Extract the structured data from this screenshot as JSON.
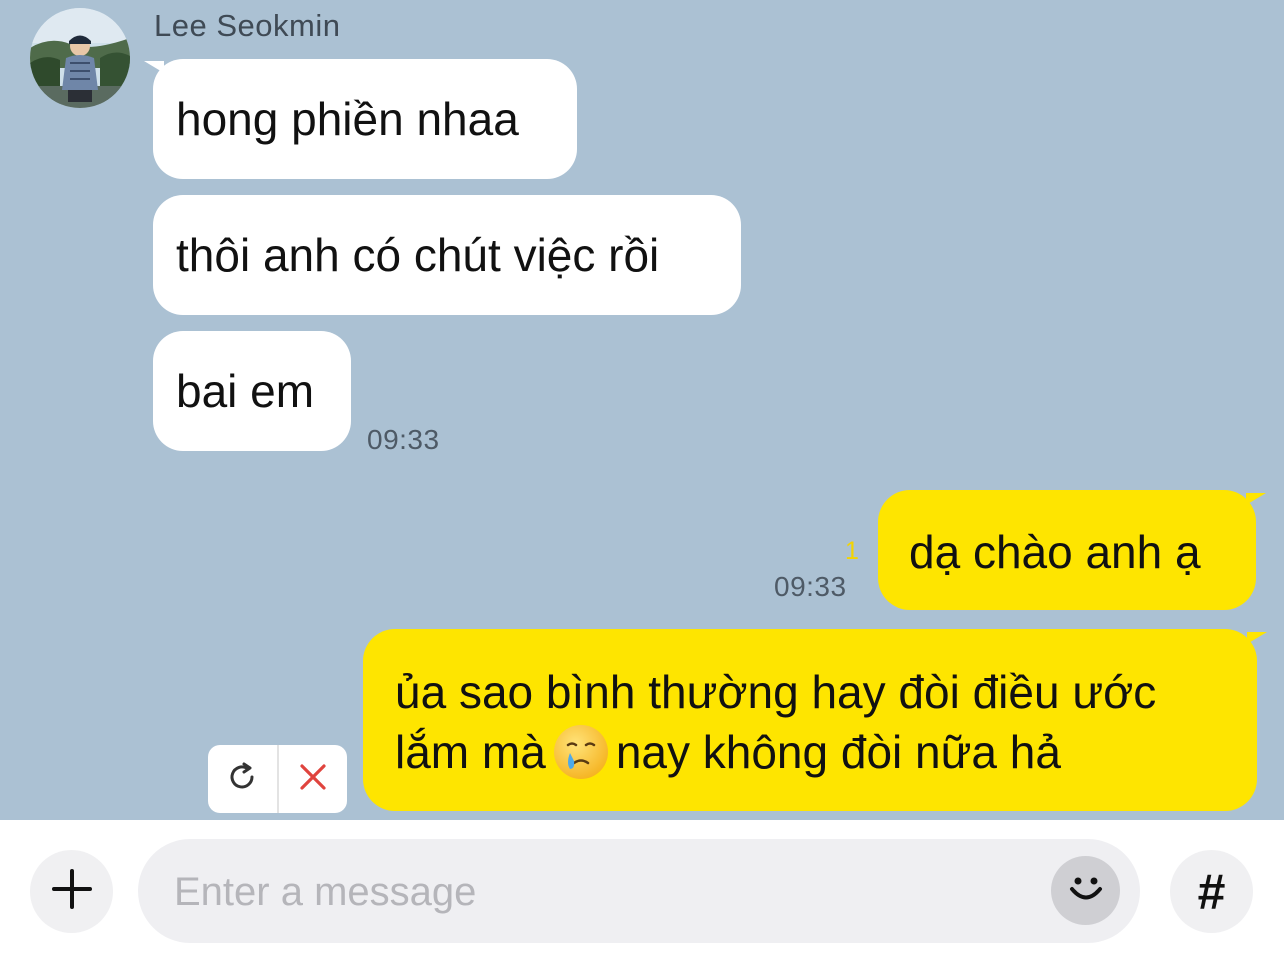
{
  "conversation": {
    "contact_name": "Lee Seokmin",
    "colors": {
      "background": "#abc1d3",
      "incoming_bubble": "#ffffff",
      "outgoing_bubble": "#fee500"
    },
    "incoming": [
      {
        "text": "hong phiền nhaa"
      },
      {
        "text": "thôi anh có chút việc rồi"
      },
      {
        "text": "bai em"
      }
    ],
    "incoming_time": "09:33",
    "outgoing": [
      {
        "text": "dạ chào anh ạ",
        "unread_count": "1",
        "time": "09:33"
      },
      {
        "line1": "ủa sao bình thường hay đòi điều ước",
        "line2_before": "lắm mà",
        "line2_emoji": "face-holding-back-tears",
        "line2_after": "nay không đòi nữa hả",
        "status": "failed"
      }
    ]
  },
  "failed_actions": {
    "retry_icon": "retry-icon",
    "delete_icon": "close-icon"
  },
  "composer": {
    "placeholder": "Enter a message",
    "plus_icon": "plus-icon",
    "emoji_icon": "smiley-icon",
    "hash_label": "#"
  }
}
